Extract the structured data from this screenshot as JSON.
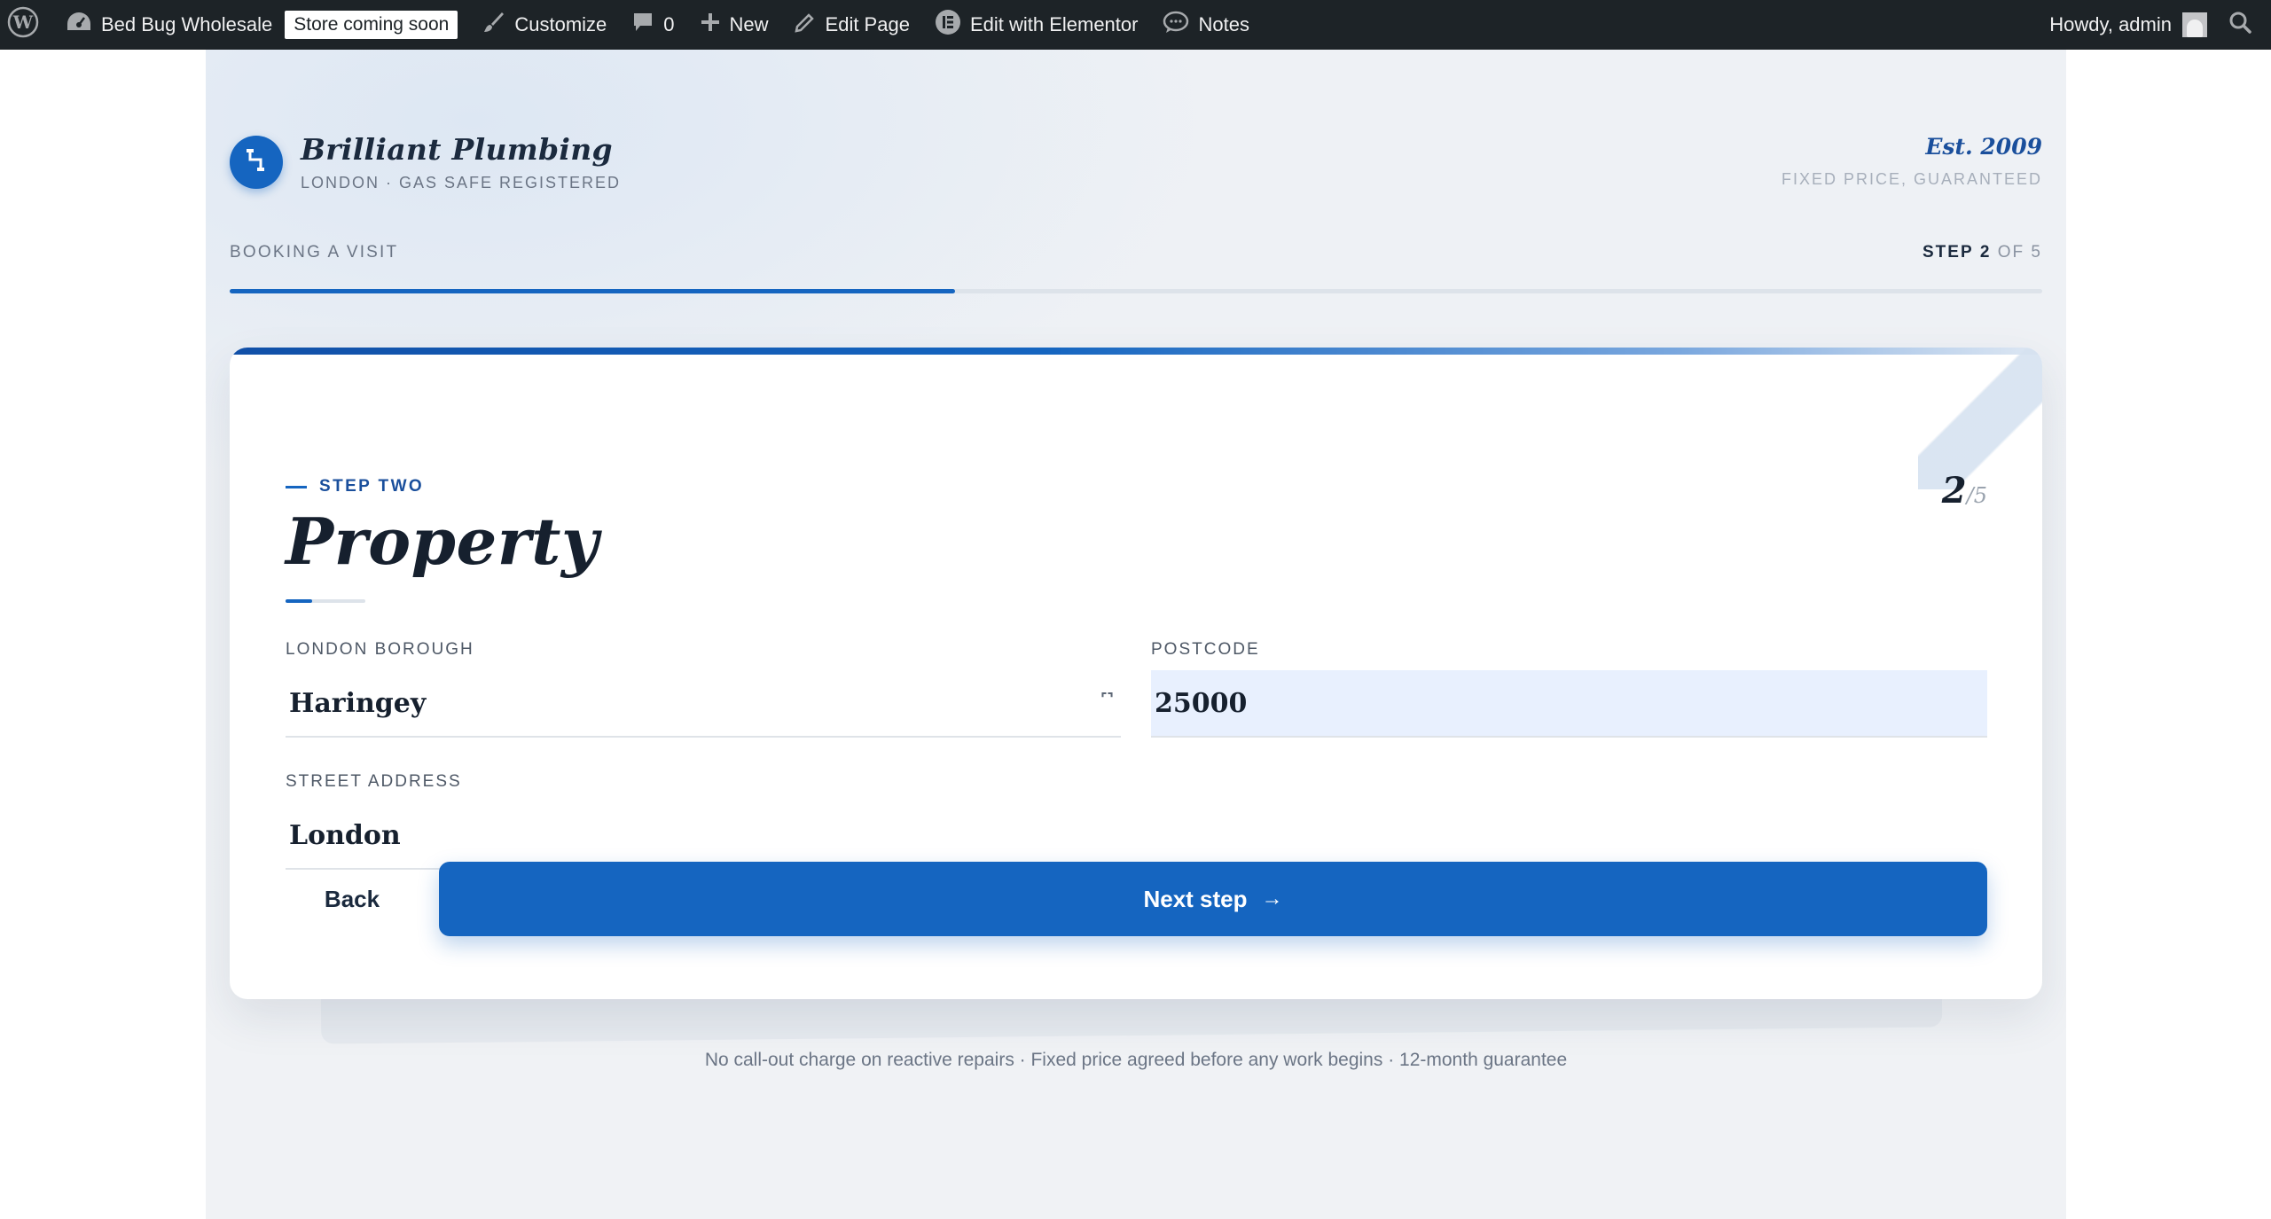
{
  "adminbar": {
    "site_name": "Bed Bug Wholesale",
    "badge": "Store coming soon",
    "customize": "Customize",
    "comments_count": "0",
    "new": "New",
    "edit_page": "Edit Page",
    "edit_elementor": "Edit with Elementor",
    "notes": "Notes",
    "howdy": "Howdy, admin"
  },
  "header": {
    "brand_name": "Brilliant Plumbing",
    "brand_tag": "LONDON · GAS SAFE REGISTERED",
    "est_title": "Est. 2009",
    "est_sub": "FIXED PRICE, GUARANTEED",
    "booking_label": "BOOKING A VISIT",
    "step_prefix": "STEP",
    "step_current": "2",
    "step_suffix": "OF 5",
    "progress_fraction": 0.4
  },
  "card": {
    "eyebrow": "STEP TWO",
    "title": "Property",
    "fraction_current": "2",
    "fraction_total": "/5",
    "fields": {
      "borough_label": "LONDON BOROUGH",
      "borough_value": "Haringey",
      "postcode_label": "POSTCODE",
      "postcode_value": "25000",
      "street_label": "STREET ADDRESS",
      "street_value": "London"
    },
    "back_label": "Back",
    "next_label": "Next step",
    "next_arrow": "→"
  },
  "footnote": "No call-out charge on reactive repairs · Fixed price agreed before any work begins · 12-month guarantee",
  "colors": {
    "accent": "#1565c0",
    "adminbar_bg": "#1d2327",
    "field_fill": "#e8f0fe"
  },
  "icons": [
    "wordpress-logo-icon",
    "dashboard-icon",
    "paintbrush-icon",
    "comment-icon",
    "plus-icon",
    "pencil-icon",
    "elementor-icon",
    "notes-icon",
    "search-icon",
    "brand-pipe-icon",
    "chevron-down-icon",
    "arrow-right-icon"
  ]
}
